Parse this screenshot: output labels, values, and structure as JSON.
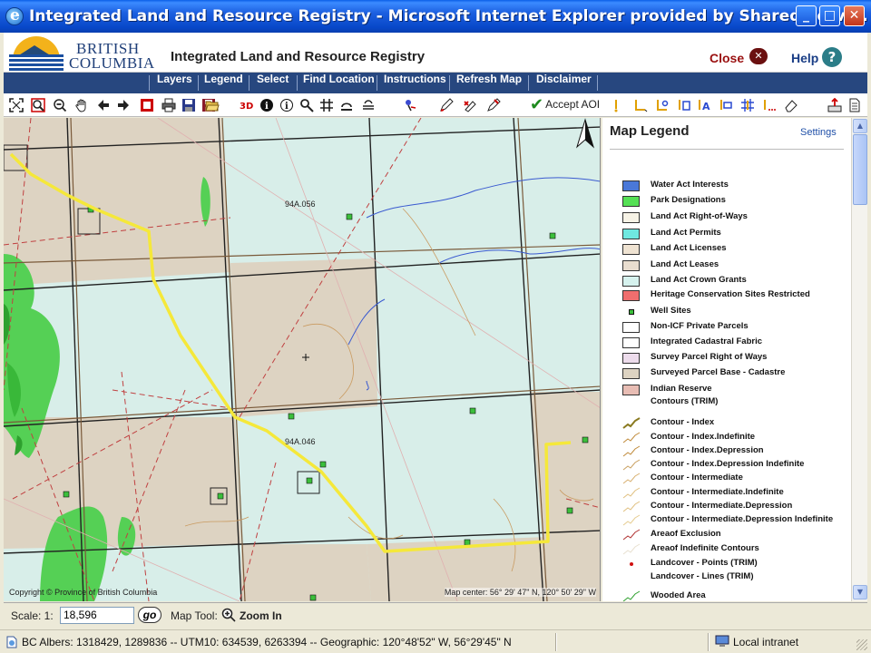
{
  "window": {
    "title": "Integrated Land and Resource Registry - Microsoft Internet Explorer provided by Shared Servi...",
    "minimize": "_",
    "maximize": "□",
    "close": "✕"
  },
  "header": {
    "logo_line1": "BRITISH",
    "logo_line2": "COLUMBIA",
    "app_title": "Integrated Land and Resource Registry",
    "close_label": "Close",
    "close_icon": "✕",
    "help_label": "Help",
    "help_icon": "?"
  },
  "nav": {
    "items": [
      "Layers",
      "Legend",
      "Select",
      "Find Location",
      "Instructions",
      "Refresh Map",
      "Disclaimer"
    ]
  },
  "toolbar": {
    "accept_aoi_label": "Accept AOI",
    "tools": [
      "zoom-extent-icon",
      "zoom-in-box-icon",
      "zoom-out-icon",
      "pan-hand-icon",
      "back-arrow-icon",
      "forward-arrow-icon",
      "overview-icon",
      "print-icon",
      "save-icon",
      "save-red-icon",
      "open-folder-icon",
      "layers-3d-icon",
      "info-icon",
      "info-outline-icon",
      "find-icon",
      "grid-icon",
      "measure-icon",
      "locate-pin-icon",
      "draw-pencil-icon",
      "erase-red-icon",
      "edit-icon",
      "check-icon",
      "label-tool-icon"
    ]
  },
  "map": {
    "copyright": "Copyright © Province of British Columbia",
    "center": "Map center: 56° 29' 47\" N, 120° 50' 29\" W",
    "labels": [
      "94A.056",
      "94A.046"
    ],
    "north_symbol": "N"
  },
  "legend": {
    "title": "Map Legend",
    "settings": "Settings",
    "items": [
      {
        "label": "Water Act Interests",
        "kind": "box",
        "color": "#4a78d8"
      },
      {
        "label": "Park Designations",
        "kind": "box",
        "color": "#55e055"
      },
      {
        "label": "Land Act Right-of-Ways",
        "kind": "box",
        "color": "#f7f3e6"
      },
      {
        "label": "Land Act Permits",
        "kind": "box",
        "color": "#6fe8e0"
      },
      {
        "label": "Land Act Licenses",
        "kind": "box",
        "color": "#efe3d2"
      },
      {
        "label": "Land Act Leases",
        "kind": "box",
        "color": "#e9ddcf"
      },
      {
        "label": "Land Act Crown Grants",
        "kind": "box",
        "color": "#d6f2ee"
      },
      {
        "label": "Heritage Conservation Sites Restricted",
        "kind": "box",
        "color": "#ef6e6e"
      },
      {
        "label": "Well Sites",
        "kind": "dot",
        "color": "#3bbf3b"
      },
      {
        "label": "Non-ICF Private Parcels",
        "kind": "box",
        "color": "#ffffff"
      },
      {
        "label": "Integrated Cadastral Fabric",
        "kind": "box",
        "color": "#ffffff"
      },
      {
        "label": "Survey Parcel Right of Ways",
        "kind": "box",
        "color": "#eddcec"
      },
      {
        "label": "Surveyed Parcel Base - Cadastre",
        "kind": "box",
        "color": "#ddd3c2"
      },
      {
        "label": "Indian Reserve",
        "kind": "box",
        "color": "#e8bdb4"
      },
      {
        "label": "Contours (TRIM)",
        "kind": "none",
        "color": ""
      },
      {
        "label": "Contour - Index",
        "kind": "line",
        "color": "#8a7a20"
      },
      {
        "label": "Contour - Index.Indefinite",
        "kind": "line",
        "color": "#c08a3a"
      },
      {
        "label": "Contour - Index.Depression",
        "kind": "line",
        "color": "#c08a3a"
      },
      {
        "label": "Contour - Index.Depression Indefinite",
        "kind": "line",
        "color": "#c9a060"
      },
      {
        "label": "Contour - Intermediate",
        "kind": "line",
        "color": "#d8b070"
      },
      {
        "label": "Contour - Intermediate.Indefinite",
        "kind": "line",
        "color": "#e0c080"
      },
      {
        "label": "Contour - Intermediate.Depression",
        "kind": "line",
        "color": "#e0c080"
      },
      {
        "label": "Contour - Intermediate.Depression Indefinite",
        "kind": "line",
        "color": "#e6cc90"
      },
      {
        "label": "Areaof Exclusion",
        "kind": "line",
        "color": "#b03030"
      },
      {
        "label": "Areaof Indefinite Contours",
        "kind": "line",
        "color": "#e8e0d0"
      },
      {
        "label": "Landcover - Points (TRIM)",
        "kind": "point",
        "color": "#d01010"
      },
      {
        "label": "Landcover - Lines (TRIM)",
        "kind": "none",
        "color": ""
      },
      {
        "label": "Wooded Area",
        "kind": "line",
        "color": "#2ea02e"
      }
    ]
  },
  "scale": {
    "label": "Scale: 1:",
    "value": "18,596",
    "go_label": "go",
    "maptool_label": "Map Tool:",
    "maptool_value": "Zoom In"
  },
  "status": {
    "text": "BC Albers: 1318429, 1289836 -- UTM10: 634539, 6263394 -- Geographic: 120°48'52\" W, 56°29'45\" N",
    "zone": "Local intranet"
  }
}
